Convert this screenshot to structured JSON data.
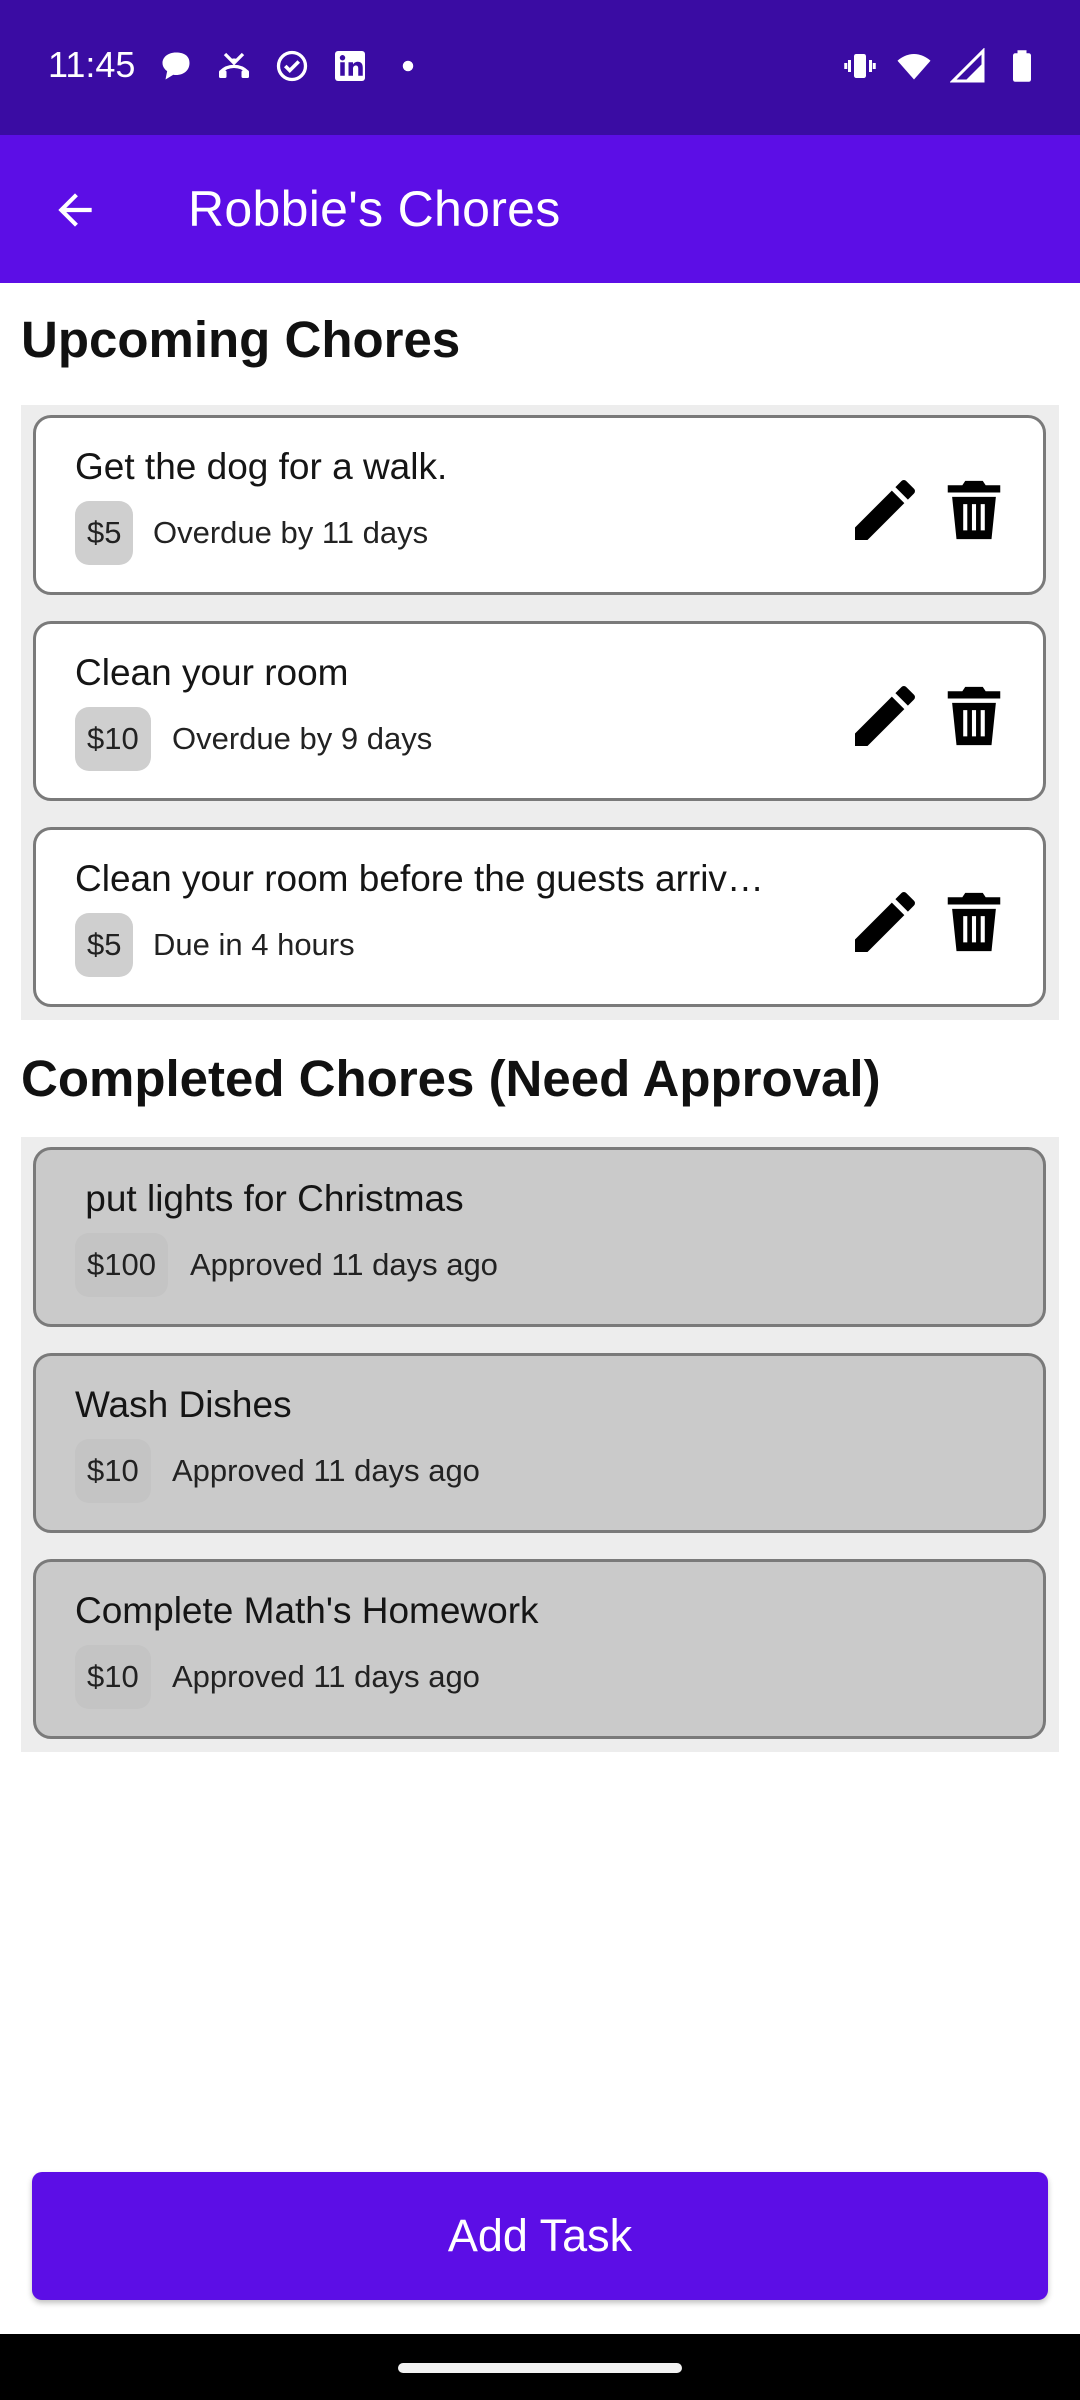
{
  "status_bar": {
    "time": "11:45",
    "left_icons": [
      "chat-bubble-icon",
      "missed-call-icon",
      "check-circle-icon",
      "linkedin-icon",
      "dot-icon"
    ],
    "right_icons": [
      "vibrate-icon",
      "wifi-icon",
      "signal-icon",
      "battery-icon"
    ]
  },
  "app_bar": {
    "back_icon": "arrow-left-icon",
    "title": "Robbie's Chores",
    "color": "#5c0ee6"
  },
  "upcoming": {
    "title": "Upcoming Chores",
    "items": [
      {
        "title": "Get the dog for a walk.",
        "price": "$5",
        "due": "Overdue by 11 days"
      },
      {
        "title": "Clean your room",
        "price": "$10",
        "due": "Overdue by 9 days"
      },
      {
        "title": "Clean your room before the guests arriv…",
        "price": "$5",
        "due": "Due in 4 hours"
      }
    ]
  },
  "completed": {
    "title": "Completed Chores (Need Approval)",
    "items": [
      {
        "title": " put lights for Christmas",
        "price": "$100",
        "status": "Approved 11 days ago"
      },
      {
        "title": "Wash Dishes",
        "price": "$10",
        "status": "Approved 11 days ago"
      },
      {
        "title": "Complete Math's Homework",
        "price": "$10",
        "status": "Approved 11 days ago"
      }
    ]
  },
  "add_task": {
    "label": "Add Task"
  }
}
